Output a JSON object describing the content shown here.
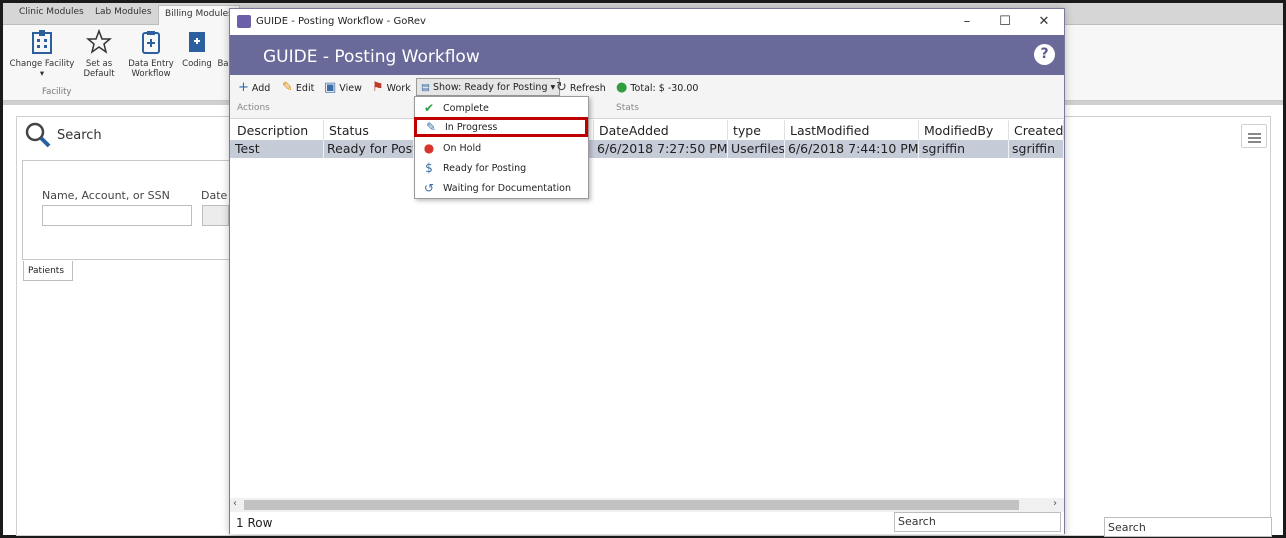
{
  "app": {
    "tabs": [
      "Clinic Modules",
      "Lab Modules",
      "Billing Modules"
    ],
    "ribbon": {
      "buttons": [
        {
          "label": "Change Facility",
          "icon": "building-icon"
        },
        {
          "label": "Set as Default",
          "icon": "star-icon"
        },
        {
          "label": "Data Entry Workflow",
          "icon": "clipboard-icon"
        },
        {
          "label": "Coding",
          "icon": "book-icon"
        },
        {
          "label": "Ba",
          "icon": "book-icon"
        }
      ],
      "group_label": "Facility"
    },
    "search_panel": {
      "title": "Search",
      "field_label": "Name, Account, or SSN",
      "date_label": "Date o",
      "tab_label": "Patients"
    },
    "bottom_search_placeholder": "Search"
  },
  "dialog": {
    "window_title": "GUIDE - Posting Workflow - GoRev",
    "header_title": "GUIDE - Posting Workflow",
    "help_label": "?",
    "toolbar": {
      "add": "Add",
      "edit": "Edit",
      "view": "View",
      "work": "Work",
      "show": "Show: Ready for Posting",
      "refresh": "Refresh",
      "total": "Total: $ -30.00",
      "actions_label": "Actions",
      "stats_label": "Stats"
    },
    "columns": [
      "Description",
      "Status",
      "DateAdded",
      "type",
      "LastModified",
      "ModifiedBy",
      "CreatedB"
    ],
    "row": {
      "description": "Test",
      "status": "Ready for Post",
      "date_added": "6/6/2018 7:27:50 PM",
      "type": "Userfiles",
      "last_modified": "6/6/2018 7:44:10 PM",
      "modified_by": "sgriffin",
      "created_by": "sgriffin"
    },
    "row_count": "1 Row",
    "search_placeholder": "Search"
  },
  "dropdown": {
    "items": [
      {
        "label": "Complete",
        "icon": "check-icon",
        "color": "#2e9e3e"
      },
      {
        "label": "In Progress",
        "icon": "edit-note-icon",
        "color": "#3a6ea5"
      },
      {
        "label": "On Hold",
        "icon": "alert-icon",
        "color": "#d9342b"
      },
      {
        "label": "Ready for Posting",
        "icon": "money-icon",
        "color": "#3a6ea5"
      },
      {
        "label": "Waiting for Documentation",
        "icon": "clock-refresh-icon",
        "color": "#3a6ea5"
      }
    ],
    "highlighted": "In Progress"
  }
}
